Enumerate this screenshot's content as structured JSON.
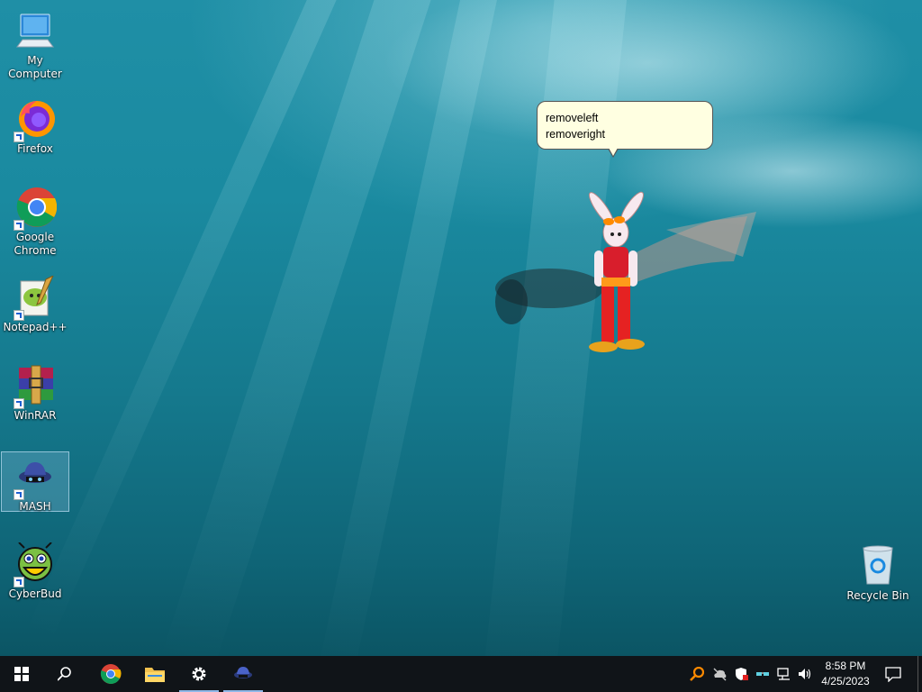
{
  "desktop": {
    "icons": [
      {
        "label": "My Computer"
      },
      {
        "label": "Firefox"
      },
      {
        "label": "Google Chrome"
      },
      {
        "label": "Notepad++"
      },
      {
        "label": "WinRAR"
      },
      {
        "label": "MASH"
      },
      {
        "label": "CyberBud"
      },
      {
        "label": "Recycle Bin"
      }
    ],
    "balloon": {
      "line1": "removeleft",
      "line2": "removeright"
    }
  },
  "taskbar": {
    "buttons": [
      "start-icon",
      "search-icon",
      "chrome-icon",
      "file-explorer-icon",
      "settings-icon",
      "mash-icon"
    ],
    "tray_icons": [
      "magnifier-tray-icon",
      "network-cloud-icon",
      "security-shield-icon",
      "glasses-icon",
      "network-icon",
      "volume-icon"
    ],
    "clock": {
      "time": "8:58 PM",
      "date": "4/25/2023"
    }
  },
  "colors": {
    "taskbar": "#101418",
    "balloon": "#ffffe1",
    "water_top": "#1f8fa6",
    "water_bottom": "#0b5564"
  }
}
